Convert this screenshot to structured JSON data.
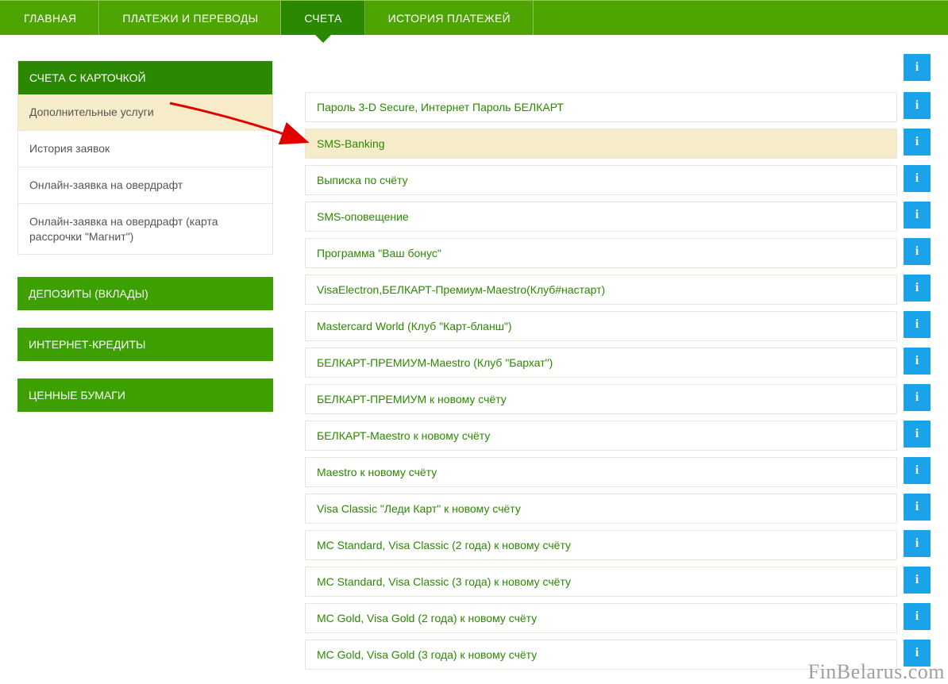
{
  "nav": {
    "tabs": [
      {
        "label": "ГЛАВНАЯ"
      },
      {
        "label": "ПЛАТЕЖИ И ПЕРЕВОДЫ"
      },
      {
        "label": "СЧЕТА",
        "active": true
      },
      {
        "label": "ИСТОРИЯ ПЛАТЕЖЕЙ"
      }
    ]
  },
  "sidebar": {
    "cards": {
      "title": "СЧЕТА С КАРТОЧКОЙ",
      "items": [
        {
          "label": "Дополнительные услуги",
          "active": true
        },
        {
          "label": "История заявок"
        },
        {
          "label": "Онлайн-заявка на овердрафт"
        },
        {
          "label": "Онлайн-заявка на овердрафт (карта рассрочки \"Магнит\")"
        }
      ]
    },
    "deposits": {
      "title": "ДЕПОЗИТЫ (ВКЛАДЫ)"
    },
    "credits": {
      "title": "ИНТЕРНЕТ-КРЕДИТЫ"
    },
    "securities": {
      "title": "ЦЕННЫЕ БУМАГИ"
    }
  },
  "services": [
    {
      "label": "Пароль 3-D Secure, Интернет Пароль БЕЛКАРТ"
    },
    {
      "label": "SMS-Banking",
      "active": true
    },
    {
      "label": "Выписка по счёту"
    },
    {
      "label": "SMS-оповещение"
    },
    {
      "label": "Программа \"Ваш бонус\""
    },
    {
      "label": "VisaElectron,БЕЛКАРТ-Премиум-Maestro(Клуб#настарт)"
    },
    {
      "label": "Mastercard World (Клуб \"Карт-бланш\")"
    },
    {
      "label": "БЕЛКАРТ-ПРЕМИУМ-Maestro (Клуб \"Бархат\")"
    },
    {
      "label": "БЕЛКАРТ-ПРЕМИУМ к новому счёту"
    },
    {
      "label": "БЕЛКАРТ-Maestro к новому счёту"
    },
    {
      "label": "Maestro к новому счёту"
    },
    {
      "label": "Visa Classic \"Леди Карт\" к новому счёту"
    },
    {
      "label": "MC Standard, Visa Classic (2 года) к новому счёту"
    },
    {
      "label": "MC Standard, Visa Classic (3 года) к новому счёту"
    },
    {
      "label": "MC Gold, Visa Gold (2 года) к новому счёту"
    },
    {
      "label": "MC Gold, Visa Gold (3 года) к новому счёту"
    }
  ],
  "info_glyph": "i",
  "watermark": "FinBelarus.com"
}
